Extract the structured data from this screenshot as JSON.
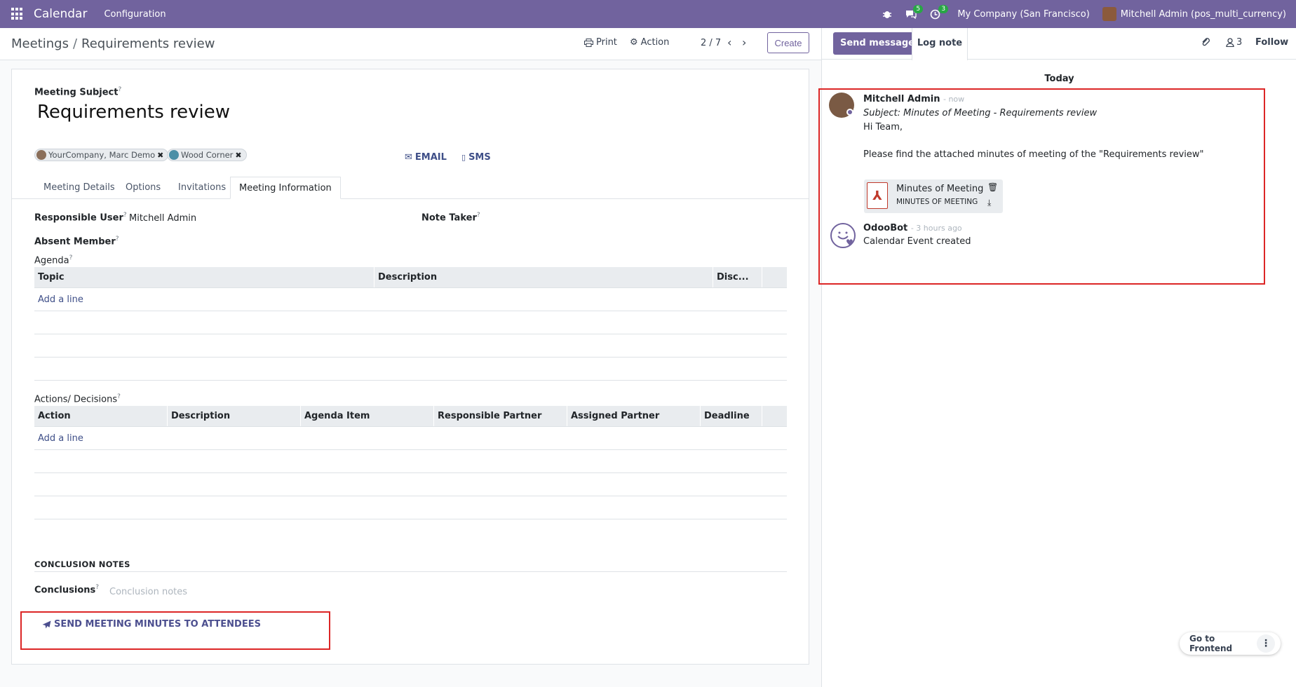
{
  "topbar": {
    "app_name": "Calendar",
    "menu_configuration": "Configuration",
    "messages_count": "5",
    "activities_count": "3",
    "company": "My Company (San Francisco)",
    "user": "Mitchell Admin (pos_multi_currency)"
  },
  "controlpanel": {
    "breadcrumb_parent": "Meetings",
    "breadcrumb_separator": "/",
    "breadcrumb_current": "Requirements review",
    "print_label": "Print",
    "action_label": "Action",
    "pager": "2 / 7",
    "create_label": "Create"
  },
  "form": {
    "subject_label": "Meeting Subject",
    "subject_value": "Requirements review",
    "attendees": [
      "YourCompany, Marc Demo",
      "Wood Corner"
    ],
    "email_label": "EMAIL",
    "sms_label": "SMS",
    "tabs": [
      "Meeting Details",
      "Options",
      "Invitations",
      "Meeting Information"
    ],
    "responsible_user_label": "Responsible User",
    "responsible_user_value": "Mitchell Admin",
    "note_taker_label": "Note Taker",
    "absent_member_label": "Absent Member",
    "help_mark": "?",
    "agenda_label": "Agenda",
    "agenda_columns": [
      "Topic",
      "Description",
      "Disc..."
    ],
    "add_line": "Add a line",
    "actions_label": "Actions/ Decisions",
    "actions_columns": [
      "Action",
      "Description",
      "Agenda Item",
      "Responsible Partner",
      "Assigned Partner",
      "Deadline"
    ],
    "conclusion_section": "CONCLUSION NOTES",
    "conclusions_label": "Conclusions",
    "conclusions_placeholder": "Conclusion notes",
    "send_minutes_label": "SEND MEETING MINUTES TO ATTENDEES"
  },
  "chatter": {
    "send_message": "Send message",
    "log_note": "Log note",
    "followers_count": "3",
    "follow_label": "Follow",
    "day_label": "Today",
    "messages": [
      {
        "author": "Mitchell Admin",
        "time": "- now",
        "subject": "Subject: Minutes of Meeting - Requirements review",
        "line1": "Hi  Team,",
        "line2": "Please find the attached minutes of meeting of the \"Requirements review\"",
        "attachment_name": "Minutes of Meeting",
        "attachment_sub": "MINUTES OF MEETING"
      },
      {
        "author": "OdooBot",
        "time": "- 3 hours ago",
        "body": "Calendar Event created"
      }
    ]
  },
  "frontend_button": "Go to Frontend",
  "colors": {
    "brand": "#71639e",
    "highlight_box": "#dc2626"
  }
}
